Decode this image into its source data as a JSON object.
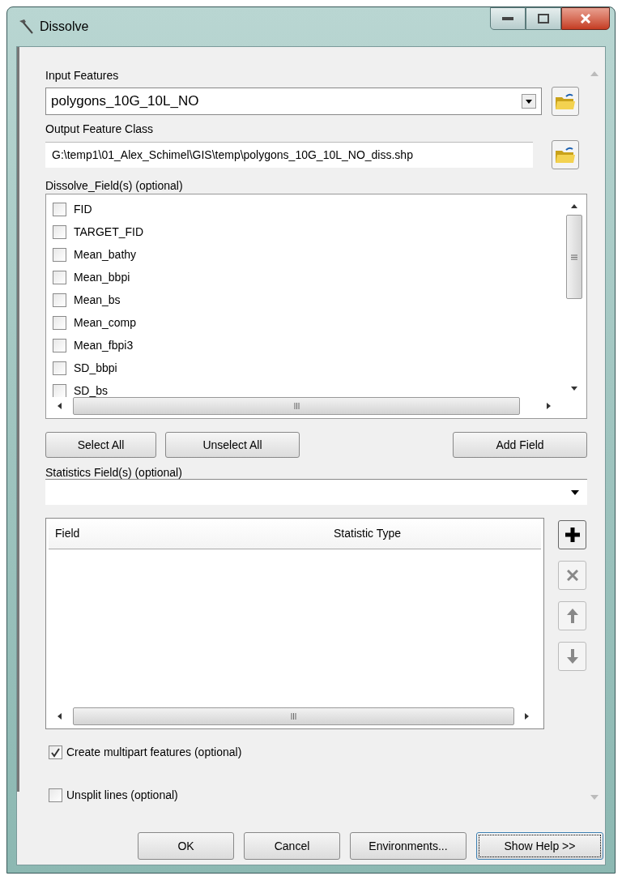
{
  "window": {
    "title": "Dissolve"
  },
  "input_features": {
    "label": "Input Features",
    "value": "polygons_10G_10L_NO"
  },
  "output_feature_class": {
    "label": "Output Feature Class",
    "value": "G:\\temp1\\01_Alex_Schimel\\GIS\\temp\\polygons_10G_10L_NO_diss.shp"
  },
  "dissolve_fields": {
    "label": "Dissolve_Field(s) (optional)",
    "items": [
      {
        "label": "FID",
        "checked": false
      },
      {
        "label": "TARGET_FID",
        "checked": false
      },
      {
        "label": "Mean_bathy",
        "checked": false
      },
      {
        "label": "Mean_bbpi",
        "checked": false
      },
      {
        "label": "Mean_bs",
        "checked": false
      },
      {
        "label": "Mean_comp",
        "checked": false
      },
      {
        "label": "Mean_fbpi3",
        "checked": false
      },
      {
        "label": "SD_bbpi",
        "checked": false
      },
      {
        "label": "SD_bs",
        "checked": false
      }
    ]
  },
  "field_buttons": [
    "Select All",
    "Unselect All",
    "Add Field"
  ],
  "statistics_fields": {
    "label": "Statistics Field(s) (optional)",
    "columns": [
      "Field",
      "Statistic Type"
    ]
  },
  "options": [
    {
      "label": "Create multipart features (optional)",
      "checked": true
    },
    {
      "label": "Unsplit lines (optional)",
      "checked": false
    }
  ],
  "buttons": [
    {
      "label": "OK",
      "focused": false
    },
    {
      "label": "Cancel",
      "focused": false
    },
    {
      "label": "Environments...",
      "focused": false
    },
    {
      "label": "Show Help >>",
      "focused": true
    }
  ]
}
